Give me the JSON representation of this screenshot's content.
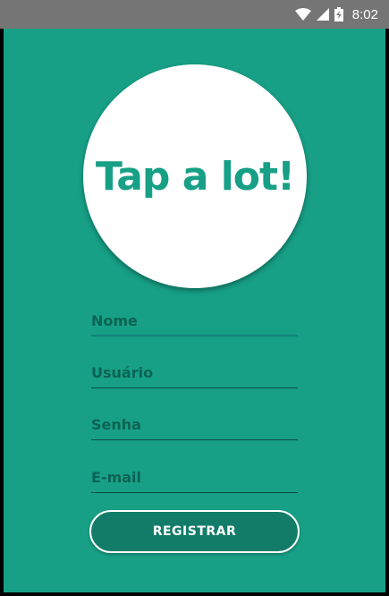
{
  "status_bar": {
    "time": "8:02",
    "icons": [
      "wifi-icon",
      "signal-icon",
      "battery-charging-icon"
    ]
  },
  "logo": {
    "text": "Tap a lot!"
  },
  "form": {
    "fields": [
      {
        "id": "nome",
        "placeholder": "Nome",
        "value": "",
        "focused": true
      },
      {
        "id": "usuario",
        "placeholder": "Usuário",
        "value": ""
      },
      {
        "id": "senha",
        "placeholder": "Senha",
        "value": ""
      },
      {
        "id": "email",
        "placeholder": "E-mail",
        "value": ""
      }
    ],
    "submit_label": "REGISTRAR"
  },
  "colors": {
    "background": "#17a086",
    "status_bar": "#757575",
    "button": "#137c69",
    "logo_circle": "#ffffff",
    "field_text": "#0b6354"
  }
}
